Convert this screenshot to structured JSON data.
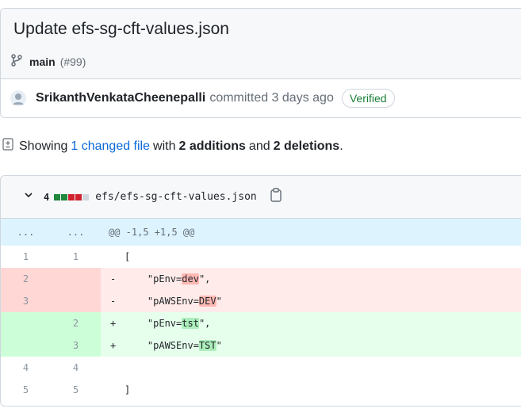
{
  "commit": {
    "title": "Update efs-sg-cft-values.json",
    "branch": "main",
    "pr": "(#99)",
    "author": "SrikanthVenkataCheenepalli",
    "action": "committed 3 days ago",
    "verified": "Verified"
  },
  "summary": {
    "showing": "Showing",
    "files_link": "1 changed file",
    "with": "with",
    "additions": "2 additions",
    "and": "and",
    "deletions": "2 deletions",
    "end": "."
  },
  "file": {
    "count": "4",
    "name": "efs/efs-sg-cft-values.json",
    "hunk_left": "...",
    "hunk_right": "...",
    "hunk_header": "@@ -1,5 +1,5 @@"
  },
  "lines": [
    {
      "type": "ctx",
      "old": "1",
      "new": "1",
      "sign": "",
      "pre": "[",
      "hl": "",
      "post": ""
    },
    {
      "type": "del",
      "old": "2",
      "new": "",
      "sign": "-",
      "pre": "    \"pEnv=",
      "hl": "dev",
      "post": "\","
    },
    {
      "type": "del",
      "old": "3",
      "new": "",
      "sign": "-",
      "pre": "    \"pAWSEnv=",
      "hl": "DEV",
      "post": "\""
    },
    {
      "type": "add",
      "old": "",
      "new": "2",
      "sign": "+",
      "pre": "    \"pEnv=",
      "hl": "tst",
      "post": "\","
    },
    {
      "type": "add",
      "old": "",
      "new": "3",
      "sign": "+",
      "pre": "    \"pAWSEnv=",
      "hl": "TST",
      "post": "\""
    },
    {
      "type": "ctx",
      "old": "4",
      "new": "4",
      "sign": "",
      "pre": "",
      "hl": "",
      "post": ""
    },
    {
      "type": "ctx",
      "old": "5",
      "new": "5",
      "sign": "",
      "pre": "]",
      "hl": "",
      "post": ""
    }
  ],
  "colors": {
    "link": "#0969da",
    "verified": "#1a7f37",
    "addition": "#1f883d",
    "deletion": "#cf222e"
  }
}
